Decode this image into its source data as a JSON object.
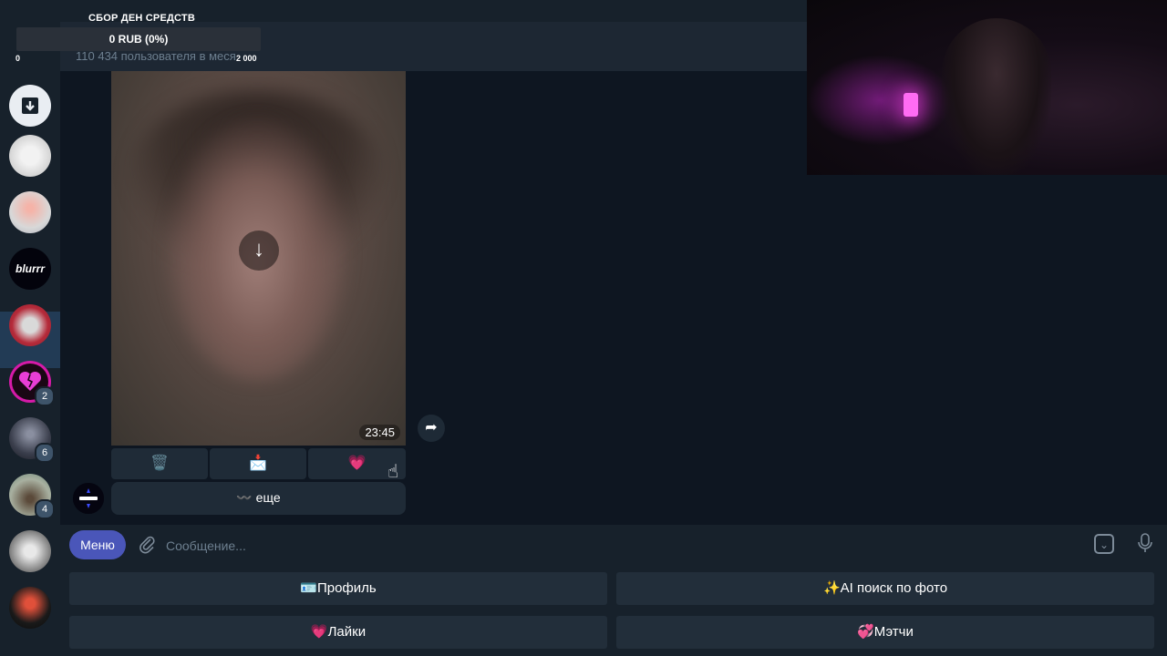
{
  "donation": {
    "title": "СБОР ДЕН СРЕДСТВ",
    "progress_text": "0 RUB (0%)",
    "progress_fraction": 0,
    "min": "0",
    "max": "2 000"
  },
  "header": {
    "subtitle": "110 434 пользователя в меся"
  },
  "sidebar": {
    "items": [
      {
        "name": "archive",
        "icon": "archive-icon"
      },
      {
        "name": "chat-manga",
        "badge": ""
      },
      {
        "name": "chat-cake",
        "badge": ""
      },
      {
        "name": "chat-blurrr",
        "badge": "",
        "active": true
      },
      {
        "name": "chat-bear",
        "badge": ""
      },
      {
        "name": "chat-broken-heart",
        "badge": "2"
      },
      {
        "name": "chat-person",
        "badge": "6"
      },
      {
        "name": "chat-outdoor",
        "badge": "4"
      },
      {
        "name": "chat-angel",
        "badge": ""
      },
      {
        "name": "chat-redhead",
        "badge": ""
      }
    ]
  },
  "message": {
    "time": "23:45",
    "inline_buttons": [
      {
        "label": "🗑️",
        "icon": "trash-icon"
      },
      {
        "label": "📩",
        "icon": "envelope-icon"
      },
      {
        "label": "💗",
        "icon": "heart-icon"
      }
    ],
    "more_label": "〰️ еще",
    "bot_name": "blurrr"
  },
  "composer": {
    "menu_label": "Меню",
    "placeholder": "Сообщение..."
  },
  "reply_keyboard": {
    "buttons": [
      {
        "label": "🪪Профиль"
      },
      {
        "label": "✨AI поиск по фото"
      },
      {
        "label": "💗Лайки"
      },
      {
        "label": "💞Мэтчи"
      }
    ]
  },
  "colors": {
    "background": "#0e1621",
    "panel": "#17212b",
    "button": "#1f2b37",
    "menu_button": "#4a56b9",
    "accent_pink": "#e83ed6"
  }
}
